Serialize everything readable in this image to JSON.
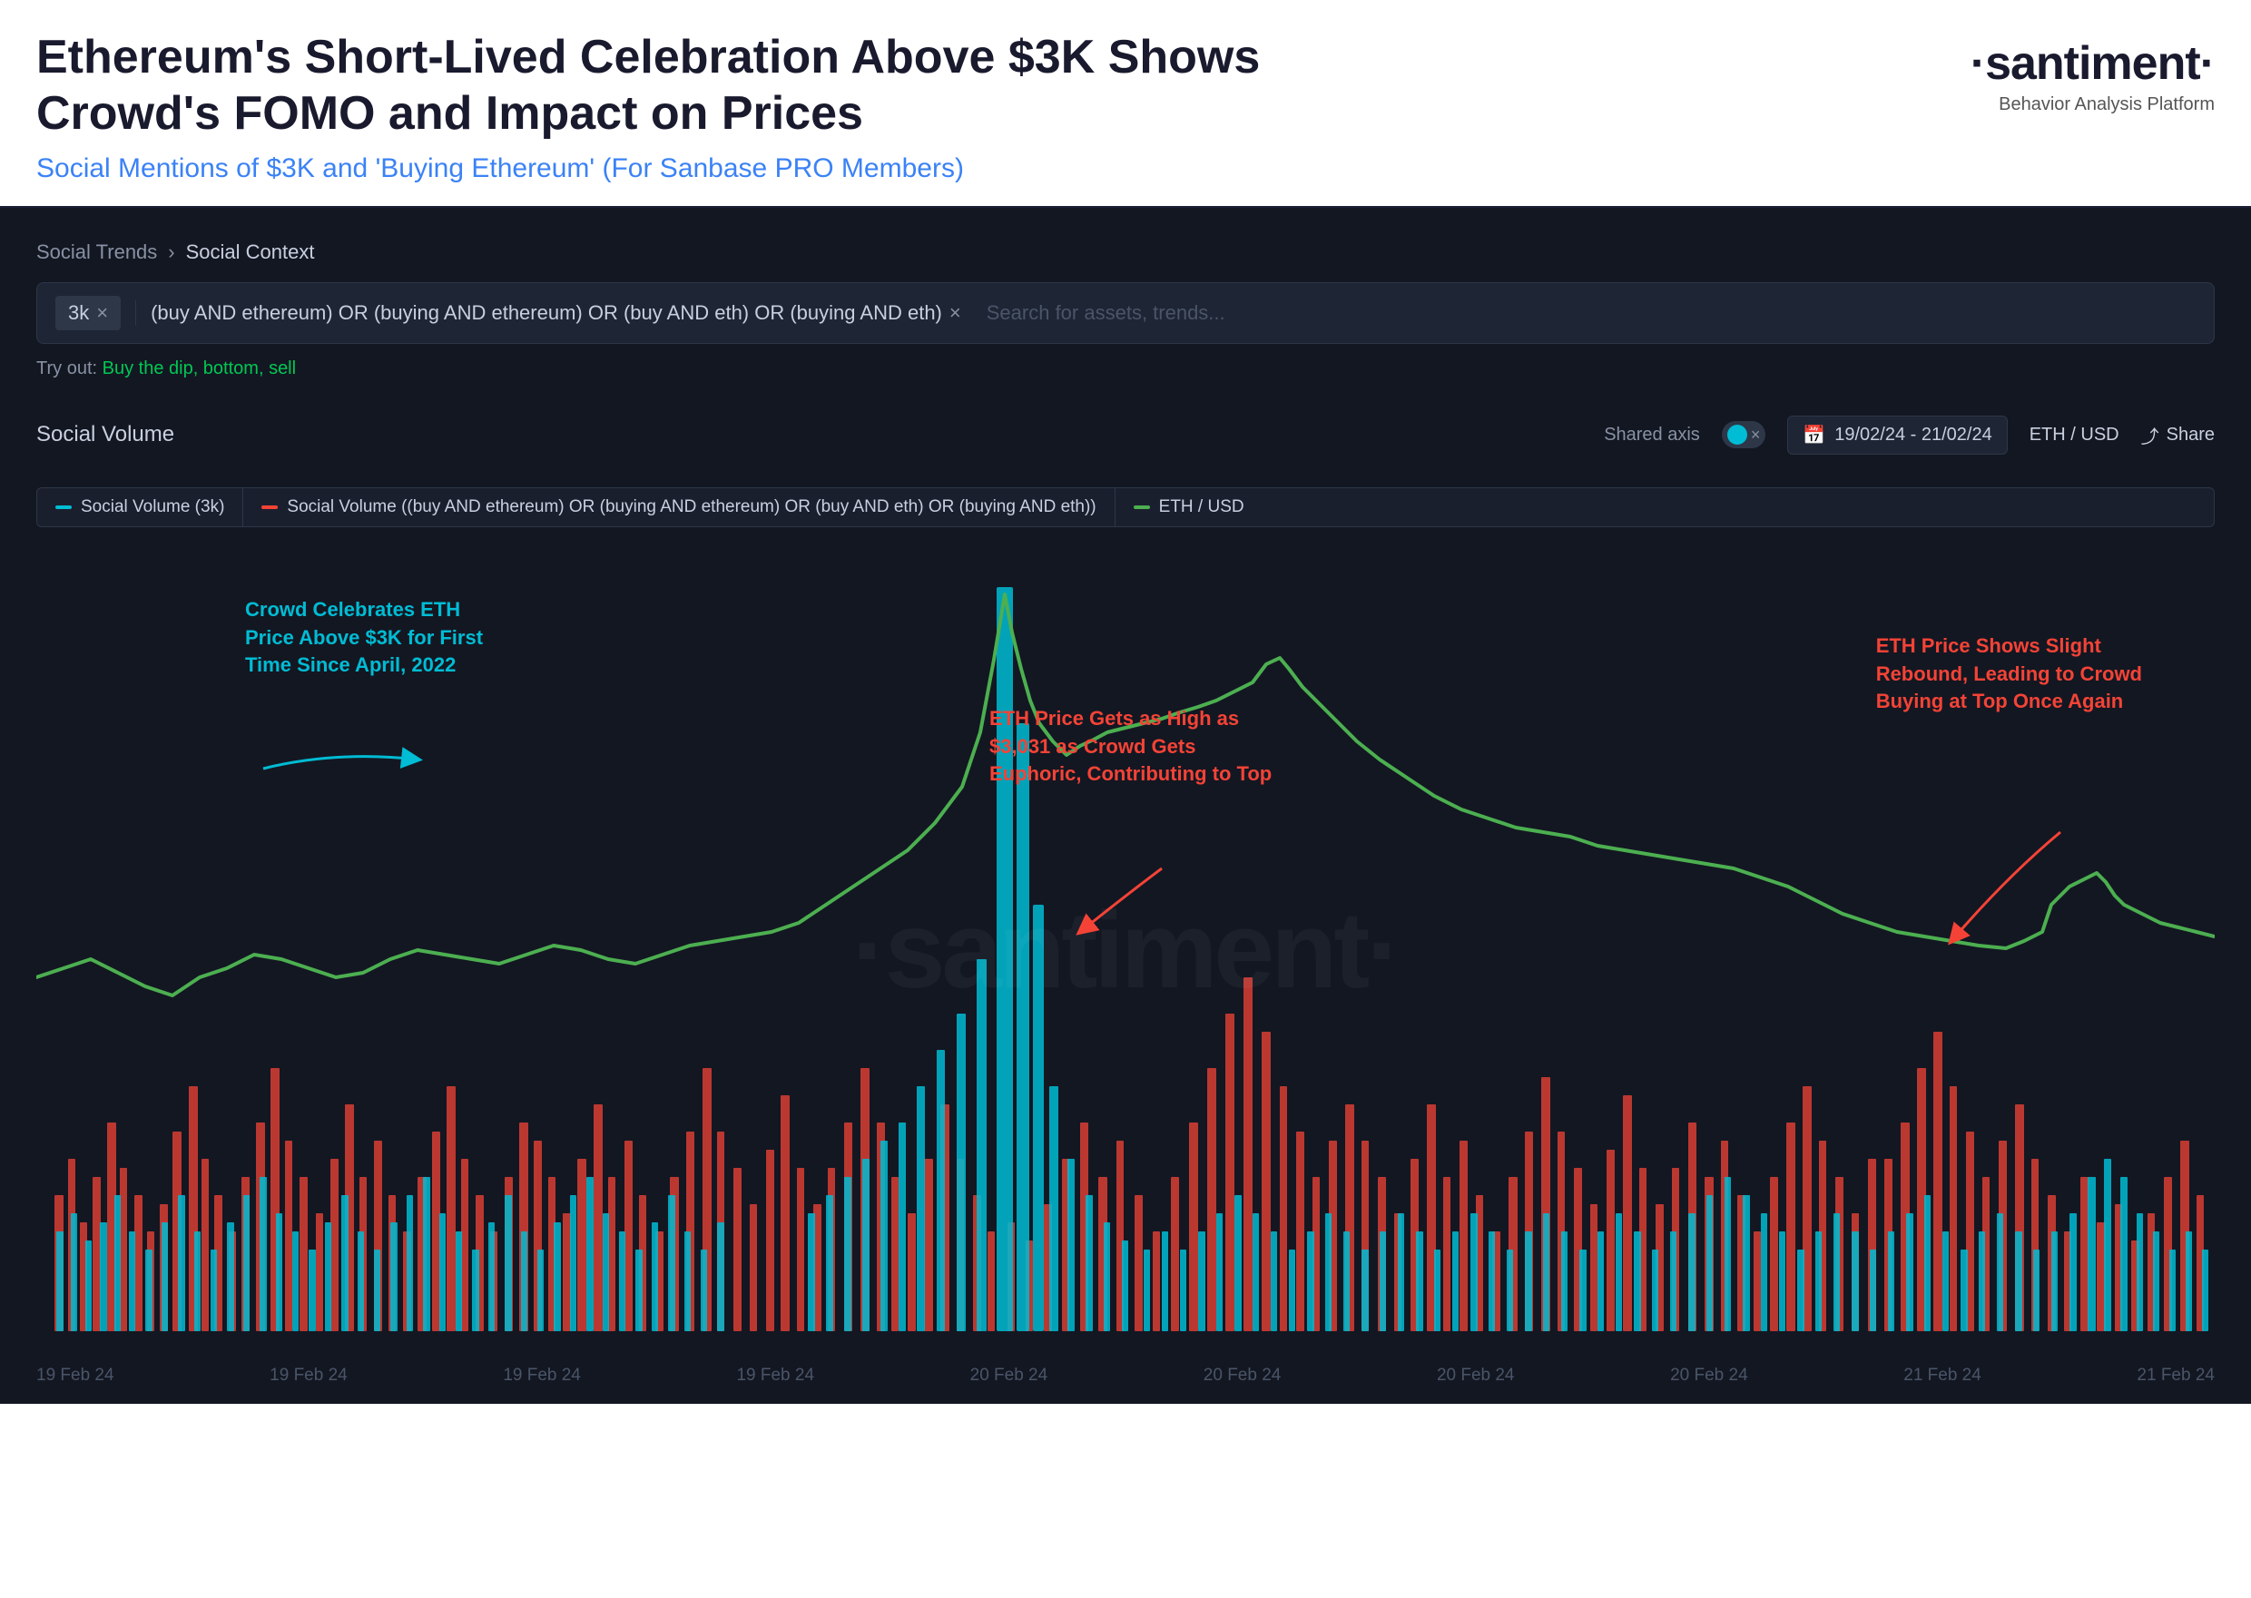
{
  "header": {
    "main_title": "Ethereum's Short-Lived Celebration Above $3K Shows\nCrowd's FOMO and Impact on Prices",
    "sub_title": "Social Mentions of $3K and 'Buying Ethereum' (For Sanbase PRO Members)",
    "brand_name": "·santiment·",
    "brand_sub": "Behavior Analysis Platform"
  },
  "breadcrumb": {
    "link": "Social Trends",
    "separator": "›",
    "current": "Social Context"
  },
  "search": {
    "tag1": "3k",
    "tag2": "(buy AND ethereum) OR (buying AND ethereum) OR (buy AND eth) OR (buying AND eth)",
    "placeholder": "Search for assets, trends...",
    "tryout_label": "Try out:",
    "tryout_links": "Buy the dip, bottom, sell"
  },
  "chart_controls": {
    "title": "Social Volume",
    "shared_axis_label": "Shared axis",
    "date_range": "19/02/24 - 21/02/24",
    "currency": "ETH / USD",
    "share": "Share"
  },
  "legend": {
    "item1": "Social Volume (3k)",
    "item2": "Social Volume ((buy AND ethereum) OR (buying AND ethereum) OR (buy AND eth) OR (buying AND eth))",
    "item3": "ETH / USD"
  },
  "annotations": {
    "ann1": {
      "text": "Crowd Celebrates ETH\nPrice Above $3K for First\nTime Since April, 2022",
      "color": "cyan"
    },
    "ann2": {
      "text": "ETH Price Gets as High as\n$3,031 as Crowd Gets\nEuphoric, Contributing to Top",
      "color": "red"
    },
    "ann3": {
      "text": "ETH Price Shows Slight\nRebound, Leading to Crowd\nBuying at Top Once Again",
      "color": "red"
    }
  },
  "x_axis_labels": [
    "19 Feb 24",
    "19 Feb 24",
    "19 Feb 24",
    "19 Feb 24",
    "20 Feb 24",
    "20 Feb 24",
    "20 Feb 24",
    "20 Feb 24",
    "21 Feb 24",
    "21 Feb 24"
  ],
  "watermark": "·santiment·",
  "icons": {
    "calendar": "📅",
    "share": "⤴",
    "close": "×"
  }
}
